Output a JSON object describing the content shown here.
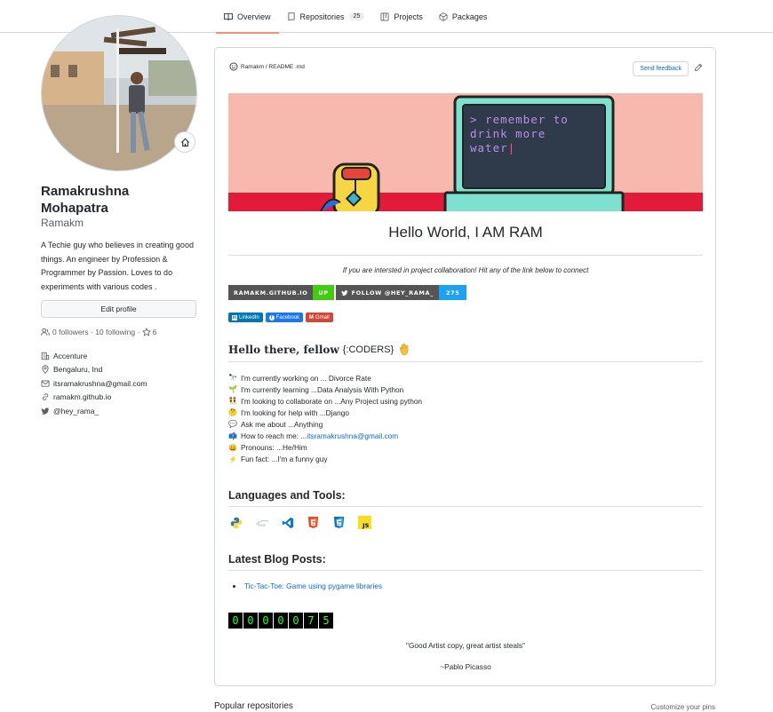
{
  "tabs": [
    {
      "label": "Overview",
      "icon": "book-icon",
      "selected": true
    },
    {
      "label": "Repositories",
      "icon": "repo-icon",
      "count": "25"
    },
    {
      "label": "Projects",
      "icon": "table-icon"
    },
    {
      "label": "Packages",
      "icon": "package-icon"
    }
  ],
  "profile": {
    "name_line1": "Ramakrushna",
    "name_line2": "Mohapatra",
    "login": "Ramakm",
    "bio": "A Techie guy who believes in creating good things. An engineer by Profession & Programmer by Passion. Loves to do experiments with various codes .",
    "edit_label": "Edit profile",
    "followers": "0 followers",
    "following": "10 following",
    "stars": "6",
    "company": "Accenture",
    "location": "Bengaluru, Ind",
    "email": "itsramakrushna@gmail.com",
    "website": "ramakm.github.io",
    "twitter": "@hey_rama_"
  },
  "readme": {
    "path": "Ramakm / README .md",
    "feedback_label": "Send feedback",
    "banner_text": [
      "> remember to",
      "drink more",
      "water"
    ],
    "title": "Hello World, I AM RAM",
    "collab_line": "If you are intersted in project collaboration! Hit any of the link below to connect",
    "badges": {
      "site_label": "RAMAKM.GITHUB.IO",
      "site_status": "UP",
      "follow_label": "FOLLOW @HEY_RAMA_",
      "follow_count": "275"
    },
    "social": [
      "LinkedIn",
      "Facebook",
      "Gmail"
    ],
    "hello_heading": "Hello there, fellow",
    "hello_coders": "{:CODERS}",
    "facts": [
      {
        "icon": "telescope-icon",
        "text": "I'm currently working on ... Divorce Rate"
      },
      {
        "icon": "seedling-icon",
        "text": "I'm currently learning ...Data Analysis With Python"
      },
      {
        "icon": "people-icon",
        "text": "I'm looking to collaborate on ...Any Project using python"
      },
      {
        "icon": "thinking-icon",
        "text": "I'm looking for help with ...Django"
      },
      {
        "icon": "speech-icon",
        "text": "Ask me about ...Anything"
      },
      {
        "icon": "mailbox-icon",
        "text": "How to reach me: ...",
        "link": "itsramakrushna@gmail.com"
      },
      {
        "icon": "smile-icon",
        "text": "Pronouns: ...He/Him"
      },
      {
        "icon": "lightning-icon",
        "text": "Fun fact: ...I'm a funny guy"
      }
    ],
    "languages_heading": "Languages and Tools:",
    "blog_heading": "Latest Blog Posts:",
    "blog_post": "Tic-Tac-Toe: Game using pygame libraries",
    "counter_digits": [
      "0",
      "0",
      "0",
      "0",
      "0",
      "7",
      "5"
    ],
    "quote": "\"Good Artist copy, great artist steals\"",
    "quote_author": "~Pablo Picasso"
  },
  "popular_label": "Popular repositories",
  "customize_label": "Customize your pins",
  "colors": {
    "accent": "#0969da",
    "tab_underline": "#fd8c73",
    "badge_dark": "#555555",
    "badge_green": "#4c1",
    "badge_blue": "#1da1f2",
    "linkedin": "#0077b5",
    "facebook": "#1877f2",
    "gmail": "#d14836"
  }
}
